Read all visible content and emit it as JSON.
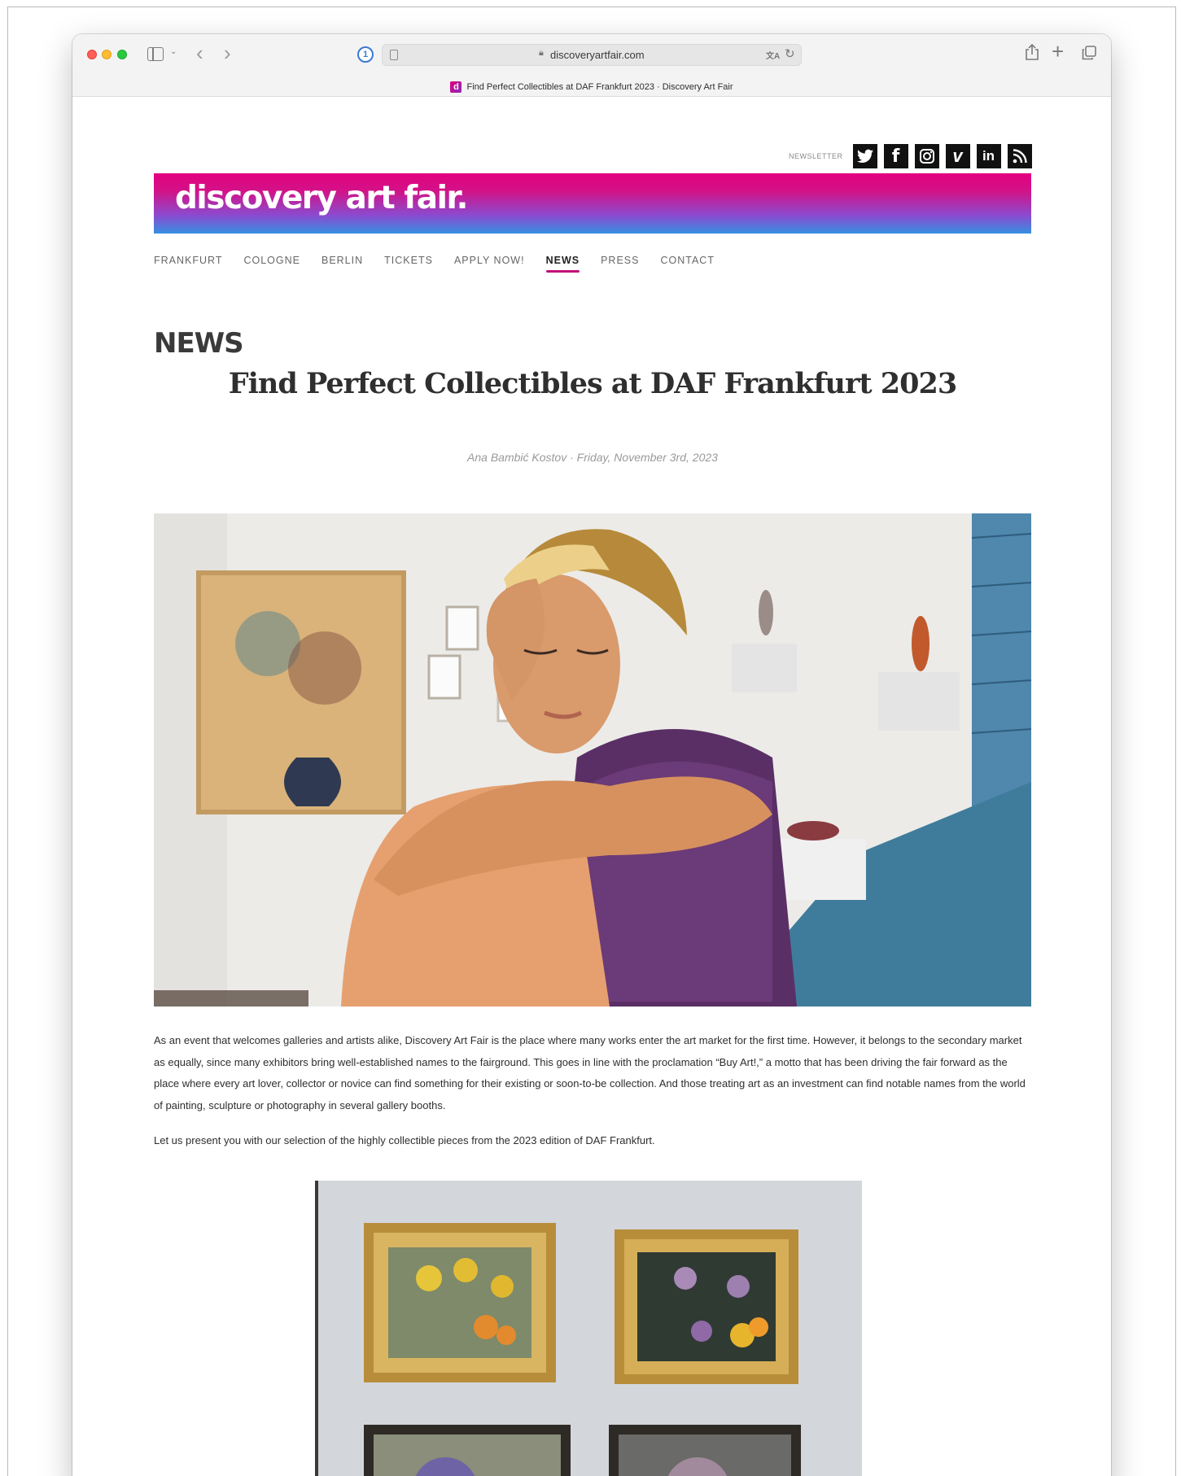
{
  "browser": {
    "url": "discoveryartfair.com",
    "tab_title": "Find Perfect Collectibles at DAF Frankfurt 2023 · Discovery Art Fair",
    "favicon_letter": "d"
  },
  "header": {
    "newsletter_label": "NEWSLETTER",
    "social": [
      {
        "name": "twitter",
        "glyph": "t"
      },
      {
        "name": "facebook",
        "glyph": "f"
      },
      {
        "name": "instagram",
        "glyph": "◎"
      },
      {
        "name": "vimeo",
        "glyph": "v"
      },
      {
        "name": "linkedin",
        "glyph": "in"
      },
      {
        "name": "rss",
        "glyph": ")"
      }
    ],
    "logo_text": "discovery art fair.",
    "brand_colors": {
      "pink": "#e3007f",
      "blue": "#3591e1"
    }
  },
  "nav": {
    "items": [
      {
        "label": "FRANKFURT"
      },
      {
        "label": "COLOGNE"
      },
      {
        "label": "BERLIN"
      },
      {
        "label": "TICKETS"
      },
      {
        "label": "APPLY NOW!"
      },
      {
        "label": "NEWS"
      },
      {
        "label": "PRESS"
      },
      {
        "label": "CONTACT"
      }
    ],
    "active": "NEWS",
    "active_color": "#c2117a"
  },
  "main": {
    "section_title": "NEWS",
    "article": {
      "title": "Find Perfect Collectibles at DAF Frankfurt 2023",
      "byline": "Ana Bambić Kostov · Friday, November 3rd, 2023",
      "paragraph1": "As an event that welcomes galleries and artists alike, Discovery Art Fair is the place where many works enter the art market for the first time. However, it belongs to the secondary market as equally, since many exhibitors bring well-established names to the fairground. This goes in line with the proclamation “Buy Art!,” a motto that has been driving the fair forward as the place where every art lover, collector or novice can find something for their existing or soon-to-be collection. And those treating art as an investment can find notable names from the world of painting, sculpture or photography in several gallery booths.",
      "paragraph2": "Let us present you with our selection of the highly collectible pieces from the 2023 edition of DAF Frankfurt."
    }
  }
}
